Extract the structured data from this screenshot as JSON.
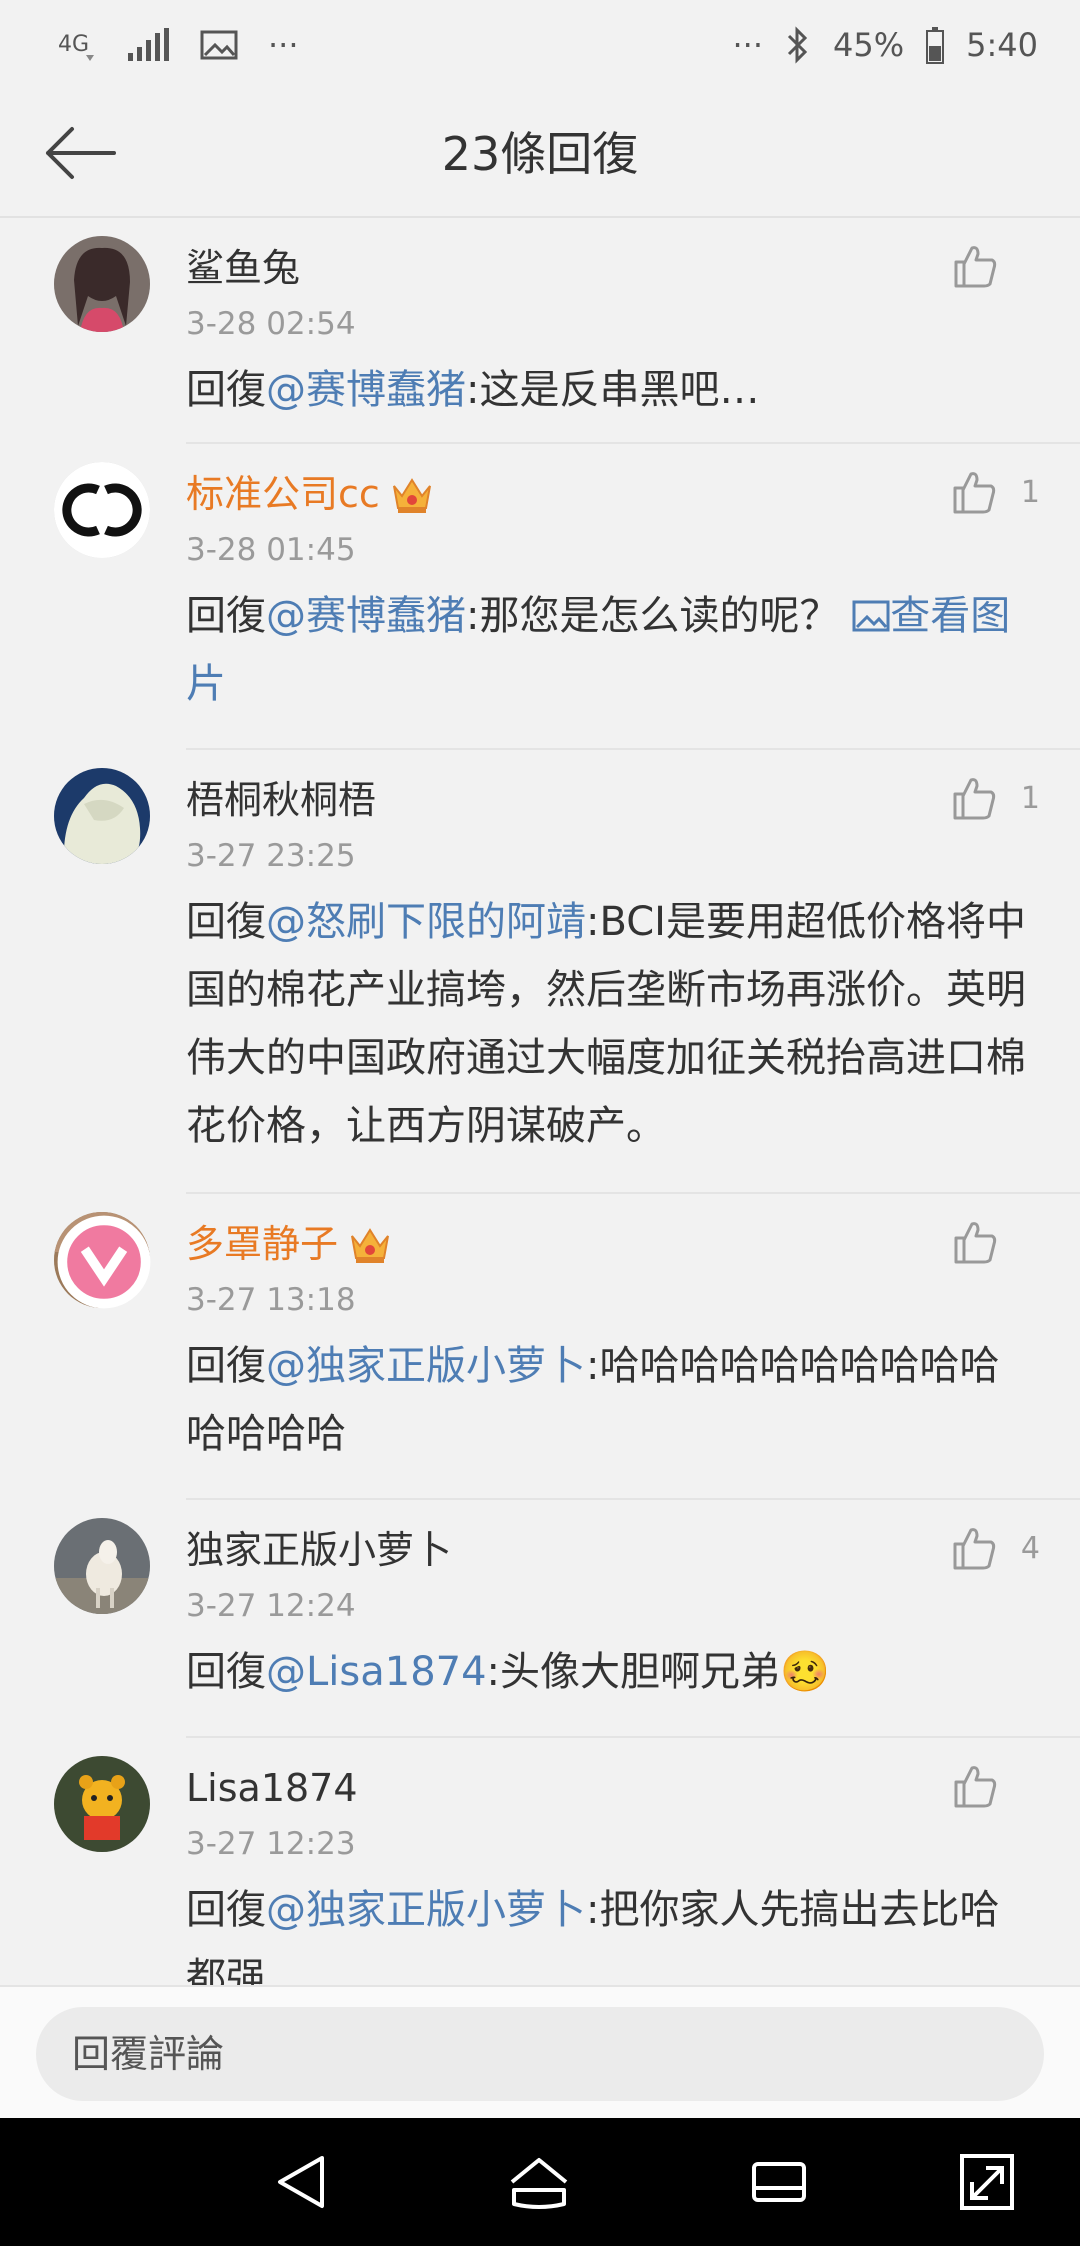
{
  "status_bar": {
    "network": "4G",
    "more": "···",
    "right_more": "···",
    "battery": "45%",
    "time": "5:40"
  },
  "header": {
    "title": "23條回復"
  },
  "replies": [
    {
      "name": "鲨鱼兔",
      "time": "3-28 02:54",
      "likes": "",
      "prefix": "回復",
      "mention": "@赛博蠢猪",
      "text": ":这是反串黑吧…",
      "link": ""
    },
    {
      "name": "标准公司cc",
      "time": "3-28 01:45",
      "likes": "1",
      "prefix": "回復",
      "mention": "@赛博蠢猪",
      "text": ":那您是怎么读的呢？",
      "link": "查看图片"
    },
    {
      "name": "梧桐秋桐梧",
      "time": "3-27 23:25",
      "likes": "1",
      "prefix": "回復",
      "mention": "@怒刷下限的阿靖",
      "text": ":BCI是要用超低价格将中国的棉花产业搞垮，然后垄断市场再涨价。英明伟大的中国政府通过大幅度加征关税抬高进口棉花价格，让西方阴谋破产。",
      "link": ""
    },
    {
      "name": "多罩静子",
      "time": "3-27 13:18",
      "likes": "",
      "prefix": "回復",
      "mention": "@独家正版小萝卜",
      "text": ":哈哈哈哈哈哈哈哈哈哈哈哈哈哈",
      "link": ""
    },
    {
      "name": "独家正版小萝卜",
      "time": "3-27 12:24",
      "likes": "4",
      "prefix": "回復",
      "mention": "@Lisa1874",
      "text": ":头像大胆啊兄弟🥴",
      "link": ""
    },
    {
      "name": "Lisa1874",
      "time": "3-27 12:23",
      "likes": "",
      "prefix": "回復",
      "mention": "@独家正版小萝卜",
      "text": ":把你家人先搞出去比哈都强",
      "link": ""
    }
  ],
  "input": {
    "placeholder": "回覆評論"
  },
  "colors": {
    "mention": "#4e7db4",
    "vip_name": "#e87a24",
    "background": "#f2f2f2"
  }
}
